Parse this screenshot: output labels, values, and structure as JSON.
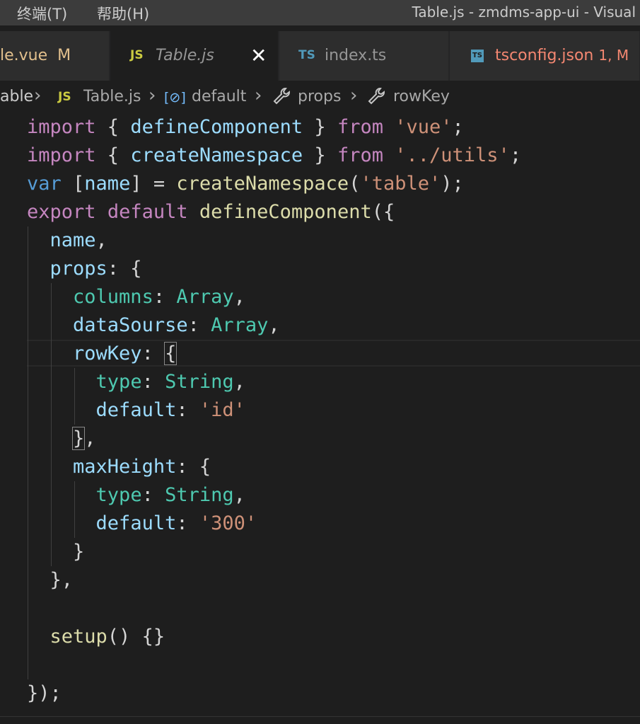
{
  "menubar": {
    "terminal": "终端(T)",
    "help": "帮助(H)",
    "window_title": "Table.js - zmdms-app-ui - Visual"
  },
  "tabs": [
    {
      "name": "le.vue",
      "status": "M"
    },
    {
      "icon_label": "JS",
      "name": "Table.js",
      "close": "✕"
    },
    {
      "icon_label": "TS",
      "name": "index.ts"
    },
    {
      "icon_label": "TS",
      "name": "tsconfig.json",
      "status": "1, M"
    }
  ],
  "breadcrumb": {
    "root": "able",
    "file_icon": "JS",
    "file": "Table.js",
    "symbol_icon": "[⊘]",
    "default": "default",
    "props": "props",
    "rowKey": "rowKey",
    "separator": "›"
  },
  "code_lines": [
    "import { defineComponent } from 'vue';",
    "import { createNamespace } from '../utils';",
    "var [name] = createNamespace('table');",
    "export default defineComponent({",
    "  name,",
    "  props: {",
    "    columns: Array,",
    "    dataSourse: Array,",
    "    rowKey: {",
    "      type: String,",
    "      default: 'id'",
    "    },",
    "    maxHeight: {",
    "      type: String,",
    "      default: '300'",
    "    }",
    "  },",
    "",
    "  setup() {}",
    "",
    "});"
  ]
}
